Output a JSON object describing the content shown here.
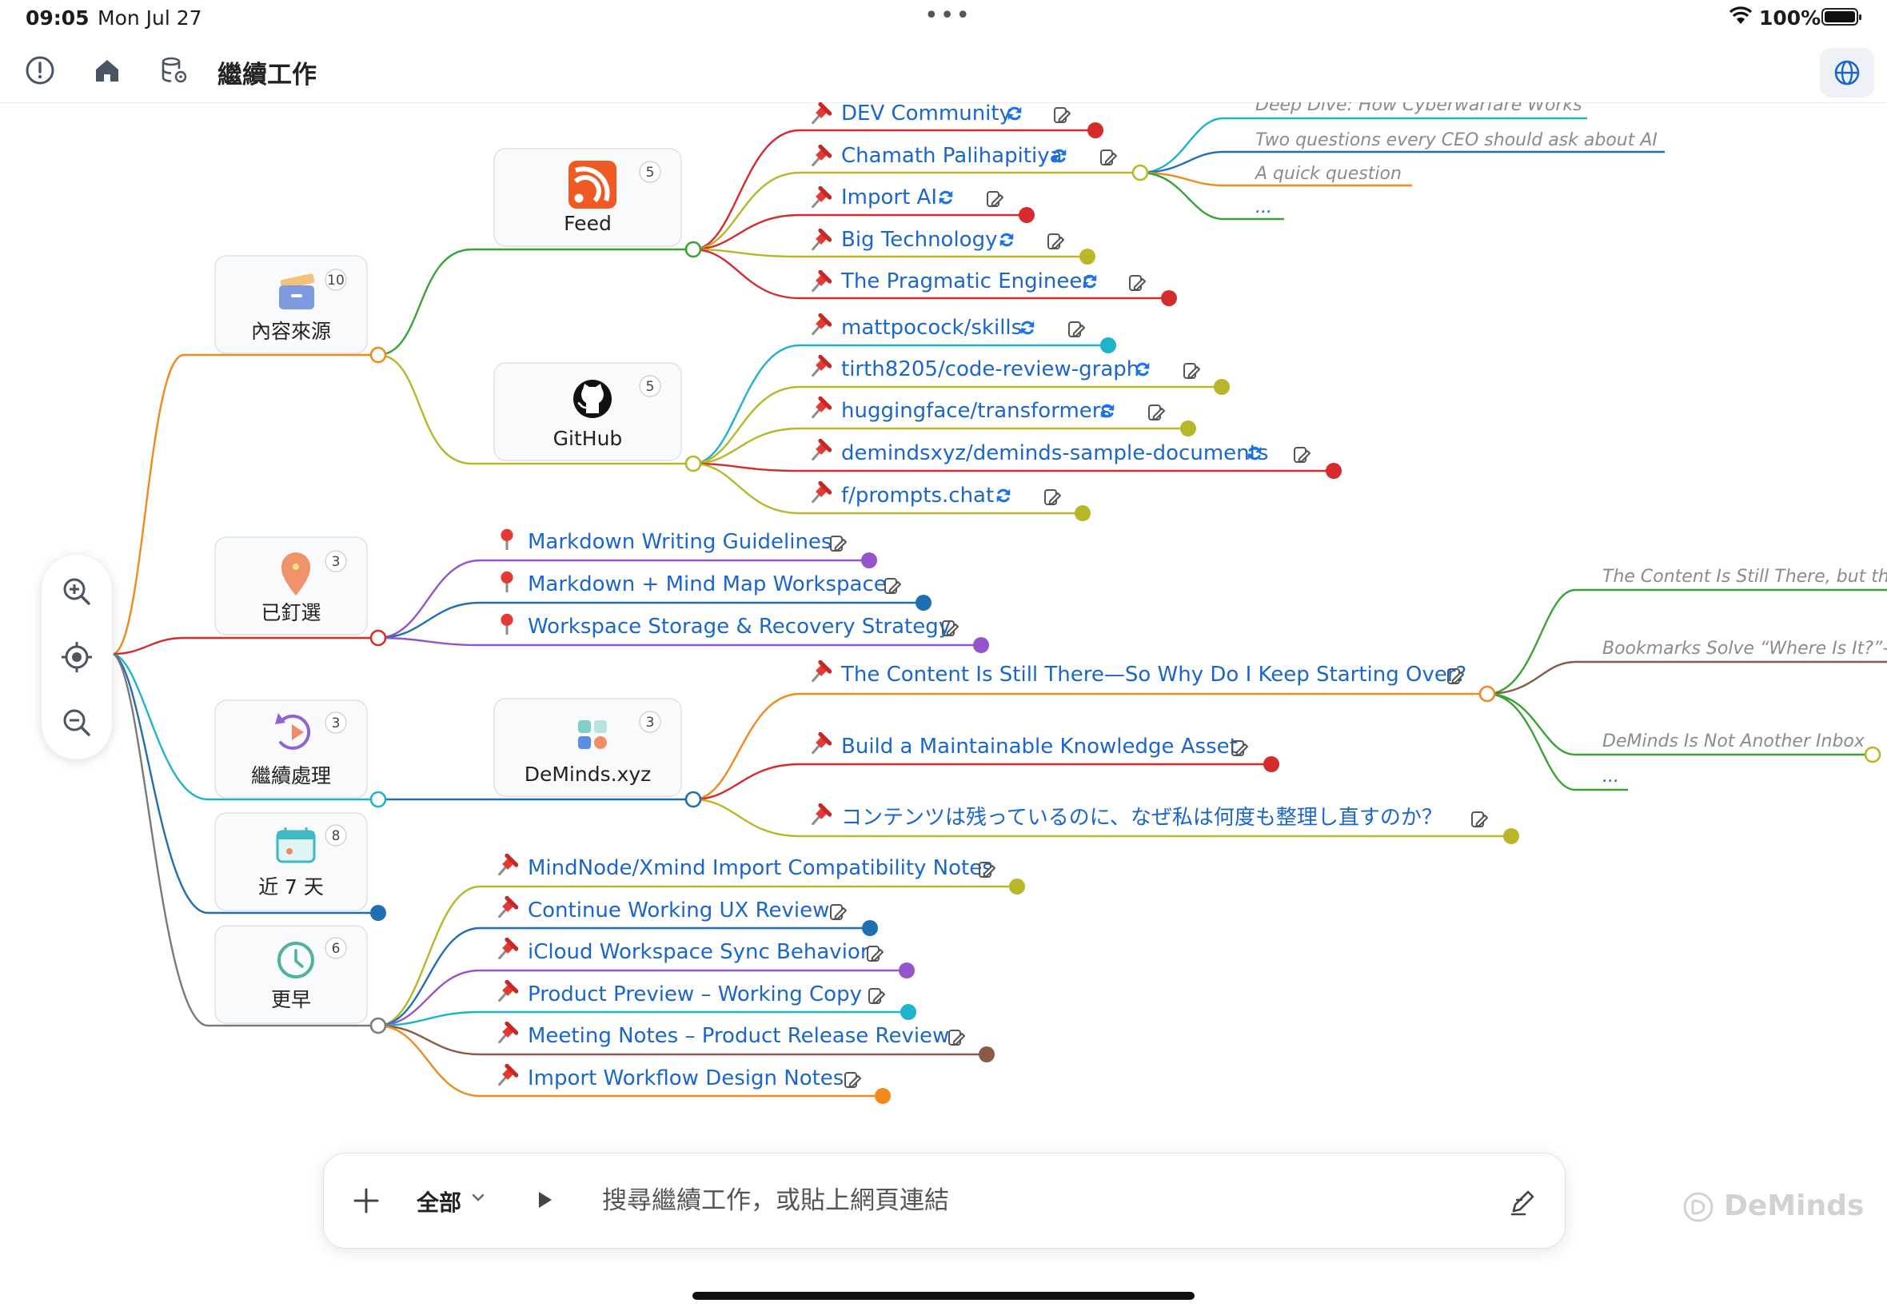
{
  "status_bar": {
    "time": "09:05",
    "date": "Mon Jul 27",
    "battery": "100%",
    "multitask_dots": "•••"
  },
  "toolbar": {
    "title": "繼續工作",
    "icons": [
      "info-icon",
      "home-icon",
      "database-icon",
      "globe-icon"
    ]
  },
  "categories": [
    {
      "id": "sources",
      "label": "內容來源",
      "count": "10",
      "icon": "inbox-icon"
    },
    {
      "id": "pinned",
      "label": "已釘選",
      "count": "3",
      "icon": "location-pin-icon"
    },
    {
      "id": "continue",
      "label": "繼續處理",
      "count": "3",
      "icon": "replay-icon"
    },
    {
      "id": "recent",
      "label": "近 7 天",
      "count": "8",
      "icon": "calendar-icon"
    },
    {
      "id": "earlier",
      "label": "更早",
      "count": "6",
      "icon": "clock-icon"
    }
  ],
  "sources": [
    {
      "label": "Feed",
      "count": "5",
      "icon": "rss-icon"
    },
    {
      "label": "GitHub",
      "count": "5",
      "icon": "github-icon"
    },
    {
      "label": "DeMinds.xyz",
      "count": "3",
      "icon": "apps-icon"
    }
  ],
  "feed_items": [
    "DEV Community",
    "Chamath Palihapitiya",
    "Import AI",
    "Big Technology",
    "The Pragmatic Engineer"
  ],
  "feed_sub_items": [
    "Deep Dive: How Cyberwarfare Works",
    "Two questions every CEO should ask about AI",
    "A quick question",
    "..."
  ],
  "github_items": [
    "mattpocock/skills",
    "tirth8205/code-review-graph",
    "huggingface/transformers",
    "demindsxyz/deminds-sample-documents",
    "f/prompts.chat"
  ],
  "pinned_items": [
    "Markdown Writing Guidelines",
    "Markdown + Mind Map Workspace",
    "Workspace Storage & Recovery Strategy"
  ],
  "deminds_items": [
    "The Content Is Still There—So Why Do I Keep Starting Over?",
    "Build a Maintainable Knowledge Asset",
    "コンテンツは残っているのに、なぜ私は何度も整理し直すのか？"
  ],
  "deminds_sub_items": [
    "The Content Is Still There, but th",
    "Bookmarks Solve “Where Is It?”–",
    "DeMinds Is Not Another Inbox",
    "..."
  ],
  "earlier_items": [
    "MindNode/Xmind Import Compatibility Notes",
    "Continue Working UX Review",
    "iCloud Workspace Sync Behavior",
    "Product Preview – Working Copy",
    "Meeting Notes – Product Release Review",
    "Import Workflow Design Notes"
  ],
  "search": {
    "scope": "全部",
    "placeholder": "搜尋繼續工作，或貼上網頁連結"
  },
  "brand": "DeMinds",
  "colors": {
    "accent": "#1a66cc",
    "orange": "#f08a1c",
    "green": "#3aa335",
    "olive": "#b7b729",
    "red": "#d62b2b",
    "purple": "#9355c9",
    "teal": "#1fb3c9",
    "navy": "#1f6fb2",
    "brown": "#8a5a44",
    "gray": "#7a7a7a"
  }
}
